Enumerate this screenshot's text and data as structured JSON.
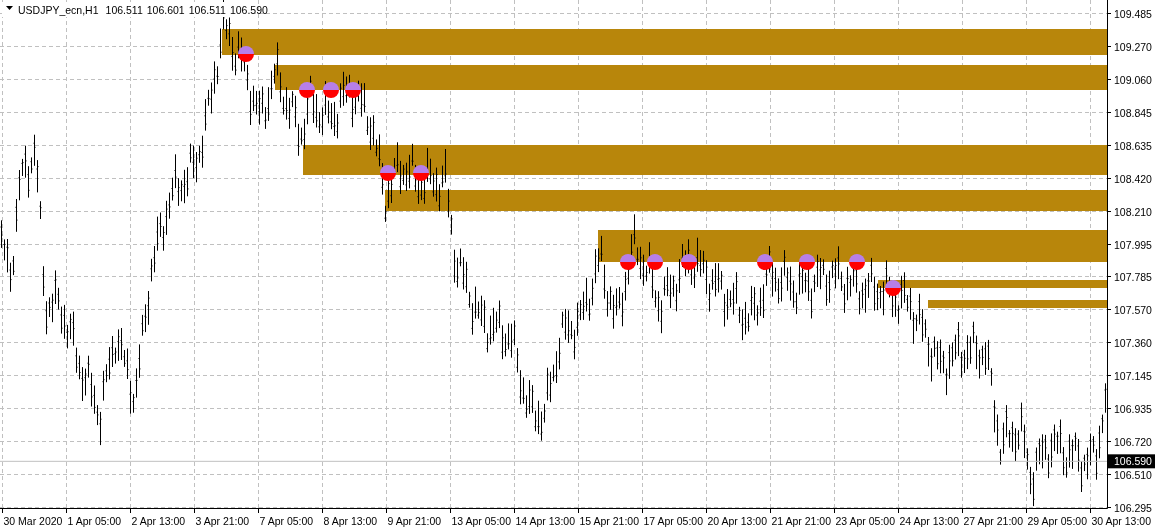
{
  "header": {
    "symbol": "USDJPY_ecn,H1",
    "quotes": [
      "106.511",
      "106.601",
      "106.511",
      "106.590"
    ]
  },
  "price_axis": {
    "ticks": [
      "109.485",
      "109.270",
      "109.060",
      "108.845",
      "108.635",
      "108.420",
      "108.210",
      "107.995",
      "107.785",
      "107.570",
      "107.360",
      "107.145",
      "106.935",
      "106.720",
      "106.510",
      "106.295"
    ],
    "current_price": "106.590"
  },
  "time_axis": {
    "ticks": [
      "30 Mar 2020",
      "1 Apr 05:00",
      "2 Apr 13:00",
      "3 Apr 21:00",
      "7 Apr 05:00",
      "8 Apr 13:00",
      "9 Apr 21:00",
      "13 Apr 05:00",
      "14 Apr 13:00",
      "15 Apr 21:00",
      "17 Apr 05:00",
      "20 Apr 13:00",
      "21 Apr 21:00",
      "23 Apr 05:00",
      "24 Apr 13:00",
      "27 Apr 21:00",
      "29 Apr 05:00",
      "30 Apr 13:00"
    ]
  }
}
